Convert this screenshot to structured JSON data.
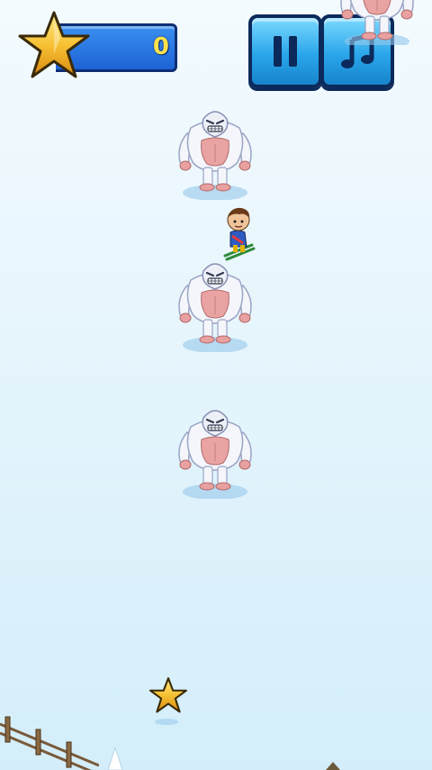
{
  "hud": {
    "score": "0",
    "pause_icon": "pause-icon",
    "music_icon": "music-note-icon",
    "score_icon": "star-icon"
  },
  "entities": {
    "player": "skier-boy",
    "obstacle": "yeti",
    "obstacle_count_visible": 4,
    "collectible": "star",
    "fence": "wooden-fence"
  },
  "colors": {
    "sky": "#eaf7fd",
    "score_panel": "#1d63d6",
    "score_text": "#ffe24a",
    "button": "#2aa6ea",
    "star": "#f5b82a"
  }
}
